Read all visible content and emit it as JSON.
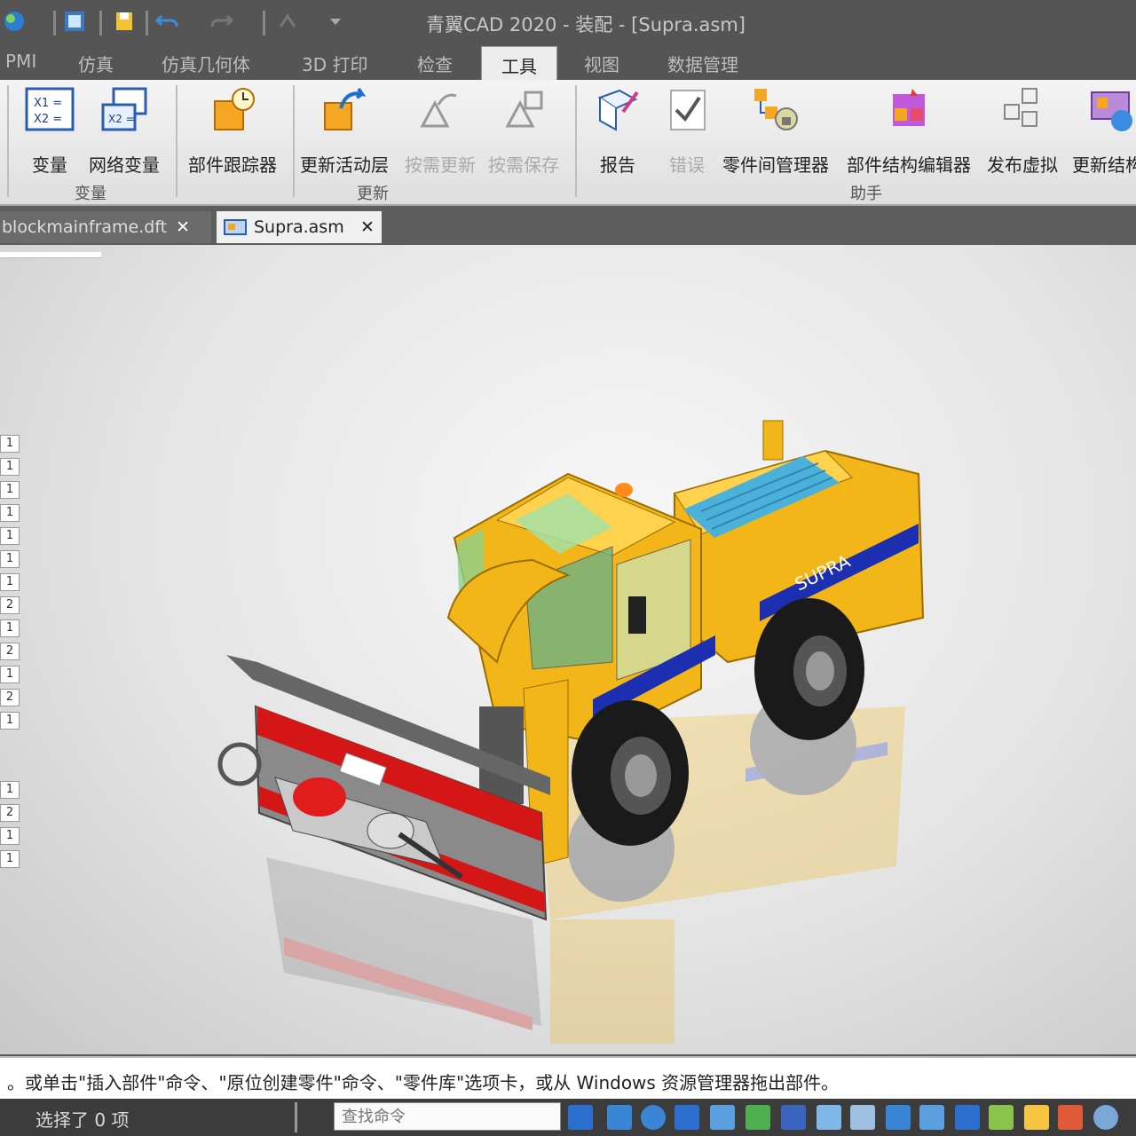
{
  "window": {
    "title": "青翼CAD 2020 - 装配 - [Supra.asm]"
  },
  "ribbon_tabs": [
    {
      "label": "PMI"
    },
    {
      "label": "仿真"
    },
    {
      "label": "仿真几何体"
    },
    {
      "label": "3D 打印"
    },
    {
      "label": "检查"
    },
    {
      "label": "工具"
    },
    {
      "label": "视图"
    },
    {
      "label": "数据管理"
    }
  ],
  "active_tab": "工具",
  "ribbon": {
    "groups": [
      {
        "label": "变量",
        "buttons": [
          {
            "label": "变量"
          },
          {
            "label": "网络变量"
          }
        ]
      },
      {
        "label": "",
        "buttons": [
          {
            "label": "部件跟踪器"
          }
        ]
      },
      {
        "label": "更新",
        "buttons": [
          {
            "label": "更新活动层"
          },
          {
            "label": "按需更新"
          },
          {
            "label": "按需保存"
          }
        ]
      },
      {
        "label": "助手",
        "buttons": [
          {
            "label": "报告"
          },
          {
            "label": "错误"
          },
          {
            "label": "零件间管理器"
          },
          {
            "label": "部件结构编辑器"
          },
          {
            "label": "发布虚拟"
          },
          {
            "label": "更新结构"
          }
        ]
      }
    ]
  },
  "documents": [
    {
      "name": "blockmainframe.dft",
      "close": "✕"
    },
    {
      "name": "Supra.asm",
      "close": "✕"
    }
  ],
  "side_counts": [
    "1",
    "1",
    "1",
    "1",
    "1",
    "1",
    "1",
    "2",
    "1",
    "2",
    "1",
    "2",
    "1",
    "1",
    "2",
    "1",
    "1"
  ],
  "model": {
    "label": "SUPRA",
    "body_color": "#f2b619",
    "stripe_color": "#1b2fb0",
    "blade_color": "#d41616"
  },
  "prompt": "。或单击\"插入部件\"命令、\"原位创建零件\"命令、\"零件库\"选项卡，或从 Windows 资源管理器拖出部件。",
  "status": {
    "selection": "选择了 0 项",
    "search_placeholder": "查找命令"
  }
}
